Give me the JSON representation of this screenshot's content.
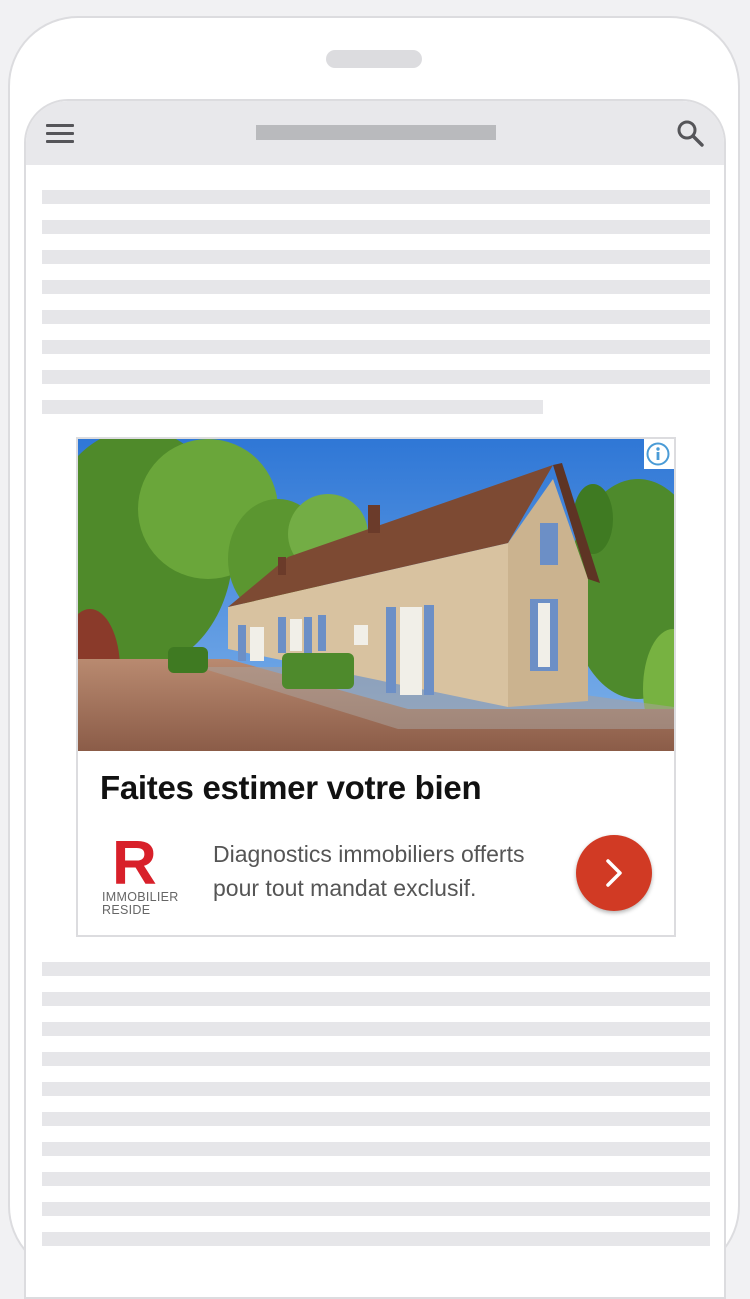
{
  "app": {
    "chrome": {
      "menu_icon": "hamburger-menu-icon",
      "search_icon": "search-icon",
      "info_icon": "info-icon",
      "cta_icon": "chevron-right-icon"
    }
  },
  "ad": {
    "headline": "Faites estimer votre bien",
    "description": "Diagnostics immobiliers offerts pour tout mandat exclusif.",
    "logo": {
      "letter": "R",
      "line1": "IMMOBILIER",
      "line2": "RESIDE"
    },
    "colors": {
      "brand": "#d8202a",
      "cta": "#d13a24",
      "info": "#4a9bd6"
    }
  },
  "colors": {
    "placeholder_line": "#e6e6e9",
    "topbar": "#e8e8eb",
    "frame": "#dcdcdf"
  }
}
